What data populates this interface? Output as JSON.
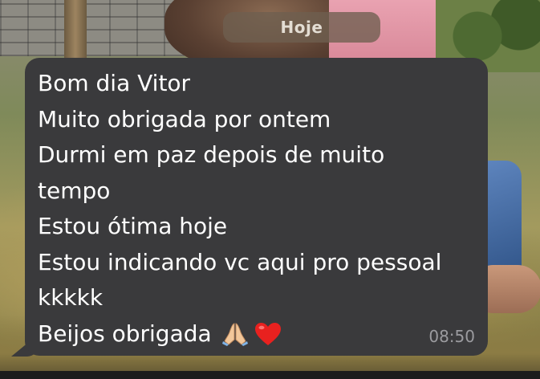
{
  "chat": {
    "date_separator": "Hoje",
    "message": {
      "lines": [
        "Bom dia Vitor",
        "Muito obrigada por ontem",
        "Durmi em paz depois de muito",
        "tempo",
        "Estou ótima hoje",
        "Estou indicando vc aqui pro pessoal",
        "kkkkk",
        "Beijos obrigada"
      ],
      "emojis": [
        "folded-hands-icon",
        "red-heart-icon"
      ],
      "time": "08:50",
      "direction": "incoming"
    }
  },
  "colors": {
    "bubble_background": "#3a3a3c",
    "message_text": "#ffffff",
    "timestamp_text": "#9b9b9f",
    "date_chip_background": "#6e5f50"
  }
}
